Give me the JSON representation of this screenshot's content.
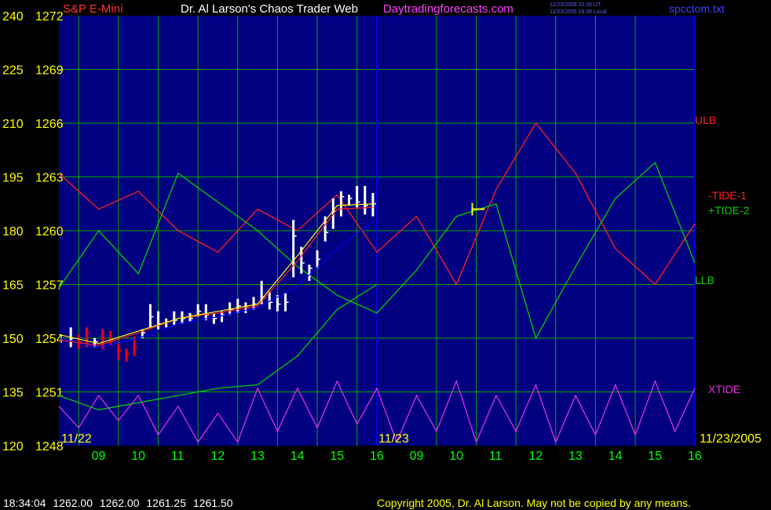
{
  "header": {
    "symbol": "S&P E-Mini",
    "title": "Dr. Al Larson's Chaos Trader Web",
    "site": "Daytradingforecasts.com",
    "stamp_utc": "11/23/2005 22:35 UT",
    "stamp_local": "11/23/2005 18:35 Local",
    "filename": "spcctom.txt"
  },
  "footer": {
    "time": "18:34:04",
    "open": "1262.00",
    "high": "1262.00",
    "low": "1261.25",
    "close": "1261.50",
    "copyright": "Copyright 2005, Dr. Al Larson. May not be copied by any means."
  },
  "colors": {
    "background": "#000080",
    "grid": "#00aa00",
    "axis_label": "#ffff00",
    "time_label": "#00ff00",
    "price_bar": "#ffffff",
    "price_bar_down": "#ff0000",
    "blue_average": "#0000ff",
    "red_average": "#ff2020",
    "yellow_average": "#ffff00",
    "red_tide": "#ff2020",
    "green_tide": "#00d000",
    "xtide": "#dd30dd",
    "marker": "#ffff00"
  },
  "chart_data": {
    "type": "line",
    "y_left_ticks": [
      "240",
      "225",
      "210",
      "195",
      "180",
      "165",
      "150",
      "135",
      "120"
    ],
    "y_price_ticks": [
      "1272",
      "1269",
      "1266",
      "1263",
      "1260",
      "1257",
      "1254",
      "1251",
      "1248"
    ],
    "ylim_price": [
      1248,
      1272
    ],
    "x_time_labels": [
      "09",
      "10",
      "11",
      "12",
      "13",
      "14",
      "15",
      "16",
      "09",
      "10",
      "11",
      "12",
      "13",
      "14",
      "15",
      "16"
    ],
    "x_hours": [
      9,
      10,
      11,
      12,
      13,
      14,
      15,
      16,
      9,
      10,
      11,
      12,
      13,
      14,
      15,
      16
    ],
    "date_labels": [
      "11/22",
      "11/23",
      "11/23/2005"
    ],
    "grid": true,
    "labels": {
      "ulb": "ULB",
      "tide1": "-TIDE-1",
      "tide2": "+TIDE-2",
      "llb": "LLB",
      "xtide": "XTIDE"
    },
    "bars": {
      "x": [
        8.3,
        8.5,
        8.7,
        8.9,
        9.1,
        9.3,
        9.5,
        9.7,
        9.9,
        10.1,
        10.3,
        10.5,
        10.7,
        10.9,
        11.1,
        11.3,
        11.5,
        11.7,
        11.9,
        12.1,
        12.3,
        12.5,
        12.7,
        12.9,
        13.1,
        13.3,
        13.5,
        13.7,
        13.9,
        14.1,
        14.3,
        14.5,
        14.7,
        14.9,
        15.1,
        15.3,
        15.5,
        15.7,
        15.9
      ],
      "high": [
        1254.6,
        1254.2,
        1254.6,
        1254.0,
        1254.5,
        1254.4,
        1253.8,
        1253.4,
        1254.1,
        1254.5,
        1255.9,
        1255.5,
        1255.1,
        1255.5,
        1255.5,
        1255.4,
        1255.9,
        1255.9,
        1255.4,
        1255.5,
        1256.0,
        1256.2,
        1256.0,
        1256.3,
        1257.2,
        1256.6,
        1256.4,
        1256.5,
        1260.6,
        1259.1,
        1258.1,
        1258.9,
        1260.8,
        1261.8,
        1262.2,
        1262.0,
        1262.5,
        1262.5,
        1262.1
      ],
      "low": [
        1253.5,
        1253.4,
        1253.5,
        1253.5,
        1253.4,
        1253.6,
        1252.8,
        1252.7,
        1253.0,
        1254.0,
        1254.6,
        1254.5,
        1254.6,
        1254.7,
        1254.8,
        1254.9,
        1255.2,
        1255.0,
        1254.8,
        1254.9,
        1255.3,
        1255.4,
        1255.4,
        1255.6,
        1255.9,
        1255.6,
        1255.5,
        1255.5,
        1257.4,
        1257.6,
        1257.2,
        1257.9,
        1259.4,
        1260.1,
        1260.8,
        1261.4,
        1261.3,
        1260.9,
        1260.8
      ],
      "close": [
        1254.0,
        1253.8,
        1254.3,
        1253.8,
        1254.0,
        1253.9,
        1253.3,
        1253.1,
        1253.5,
        1254.3,
        1255.2,
        1254.8,
        1254.9,
        1255.0,
        1255.1,
        1255.1,
        1255.5,
        1255.3,
        1255.1,
        1255.3,
        1255.6,
        1255.8,
        1255.7,
        1255.9,
        1256.3,
        1256.0,
        1255.9,
        1256.0,
        1259.7,
        1258.2,
        1257.9,
        1258.4,
        1259.9,
        1261.1,
        1261.9,
        1261.8,
        1261.6,
        1261.4,
        1261.5
      ],
      "down_flags": [
        false,
        true,
        true,
        false,
        true,
        true,
        true,
        true,
        true,
        false,
        false,
        false,
        false,
        false,
        false,
        false,
        false,
        false,
        false,
        false,
        false,
        false,
        false,
        false,
        false,
        false,
        false,
        false,
        false,
        false,
        false,
        false,
        false,
        false,
        false,
        false,
        false,
        false,
        false
      ]
    },
    "series": [
      {
        "label_key": "ulb",
        "role": "red_tide",
        "x": [
          8,
          9,
          10,
          11,
          12,
          13,
          14,
          15,
          16,
          17,
          18,
          19,
          20,
          21,
          22,
          23,
          24
        ],
        "y": [
          196.0,
          186.0,
          191.0,
          180.0,
          174.0,
          186.0,
          180.0,
          190.0,
          174.0,
          184.0,
          165.0,
          191.5,
          210.0,
          196.0,
          175.0,
          165.0,
          182.0
        ]
      },
      {
        "label_key": "tide2",
        "role": "green_tide",
        "x": [
          8,
          9,
          10,
          11,
          12,
          13,
          14,
          15,
          16,
          17,
          18,
          19,
          20,
          21,
          22,
          23,
          24
        ],
        "y": [
          164.0,
          180.0,
          168.0,
          196.0,
          188.0,
          180.0,
          170.0,
          162.0,
          157.0,
          169.0,
          184.0,
          187.5,
          150.0,
          170.0,
          189.0,
          199.0,
          171.0
        ]
      },
      {
        "label_key": "llb",
        "role": "green_tide",
        "x": [
          8,
          9,
          10,
          11,
          12,
          13,
          14,
          15,
          16
        ],
        "y": [
          134.0,
          130.0,
          132.0,
          134.0,
          136.0,
          137.0,
          145.0,
          158.0,
          165.0
        ]
      },
      {
        "label_key": "xtide",
        "role": "xtide",
        "x": [
          8.0,
          8.5,
          9.0,
          9.5,
          10.0,
          10.5,
          11.0,
          11.5,
          12.0,
          12.5,
          13.0,
          13.5,
          14.0,
          14.5,
          15.0,
          15.5,
          16.0,
          16.5,
          17.0,
          17.5,
          18.0,
          18.5,
          19.0,
          19.5,
          20.0,
          20.5,
          21.0,
          21.5,
          22.0,
          22.5,
          23.0,
          23.5,
          24.0
        ],
        "y": [
          131.0,
          125.0,
          134.0,
          127.0,
          134.0,
          123.0,
          131.0,
          121.0,
          129.0,
          121.0,
          136.0,
          124.0,
          136.0,
          125.0,
          138.0,
          126.0,
          136.0,
          121.0,
          134.0,
          124.0,
          138.0,
          121.0,
          134.0,
          124.0,
          137.0,
          121.0,
          134.0,
          123.0,
          137.0,
          123.0,
          138.0,
          124.0,
          136.0
        ]
      }
    ],
    "averages": [
      {
        "role": "blue_average",
        "x": [
          8,
          9,
          10,
          11,
          12,
          13,
          14,
          15,
          15.9
        ],
        "y": [
          1254.0,
          1253.5,
          1254.0,
          1254.8,
          1255.2,
          1255.7,
          1256.9,
          1259.0,
          1260.5
        ]
      },
      {
        "role": "red_average",
        "x": [
          8,
          9,
          10,
          11,
          12,
          13,
          14,
          15,
          15.9
        ],
        "y": [
          1253.9,
          1253.6,
          1254.3,
          1255.1,
          1255.4,
          1255.8,
          1258.3,
          1261.2,
          1261.3
        ]
      },
      {
        "role": "yellow_average",
        "x": [
          8,
          9,
          10,
          11,
          12,
          13,
          14,
          15,
          15.9
        ],
        "y": [
          1254.2,
          1253.7,
          1254.4,
          1255.1,
          1255.5,
          1255.9,
          1258.6,
          1261.4,
          1261.5
        ]
      }
    ],
    "marker": {
      "x": 18.4,
      "y": 186.0
    }
  }
}
